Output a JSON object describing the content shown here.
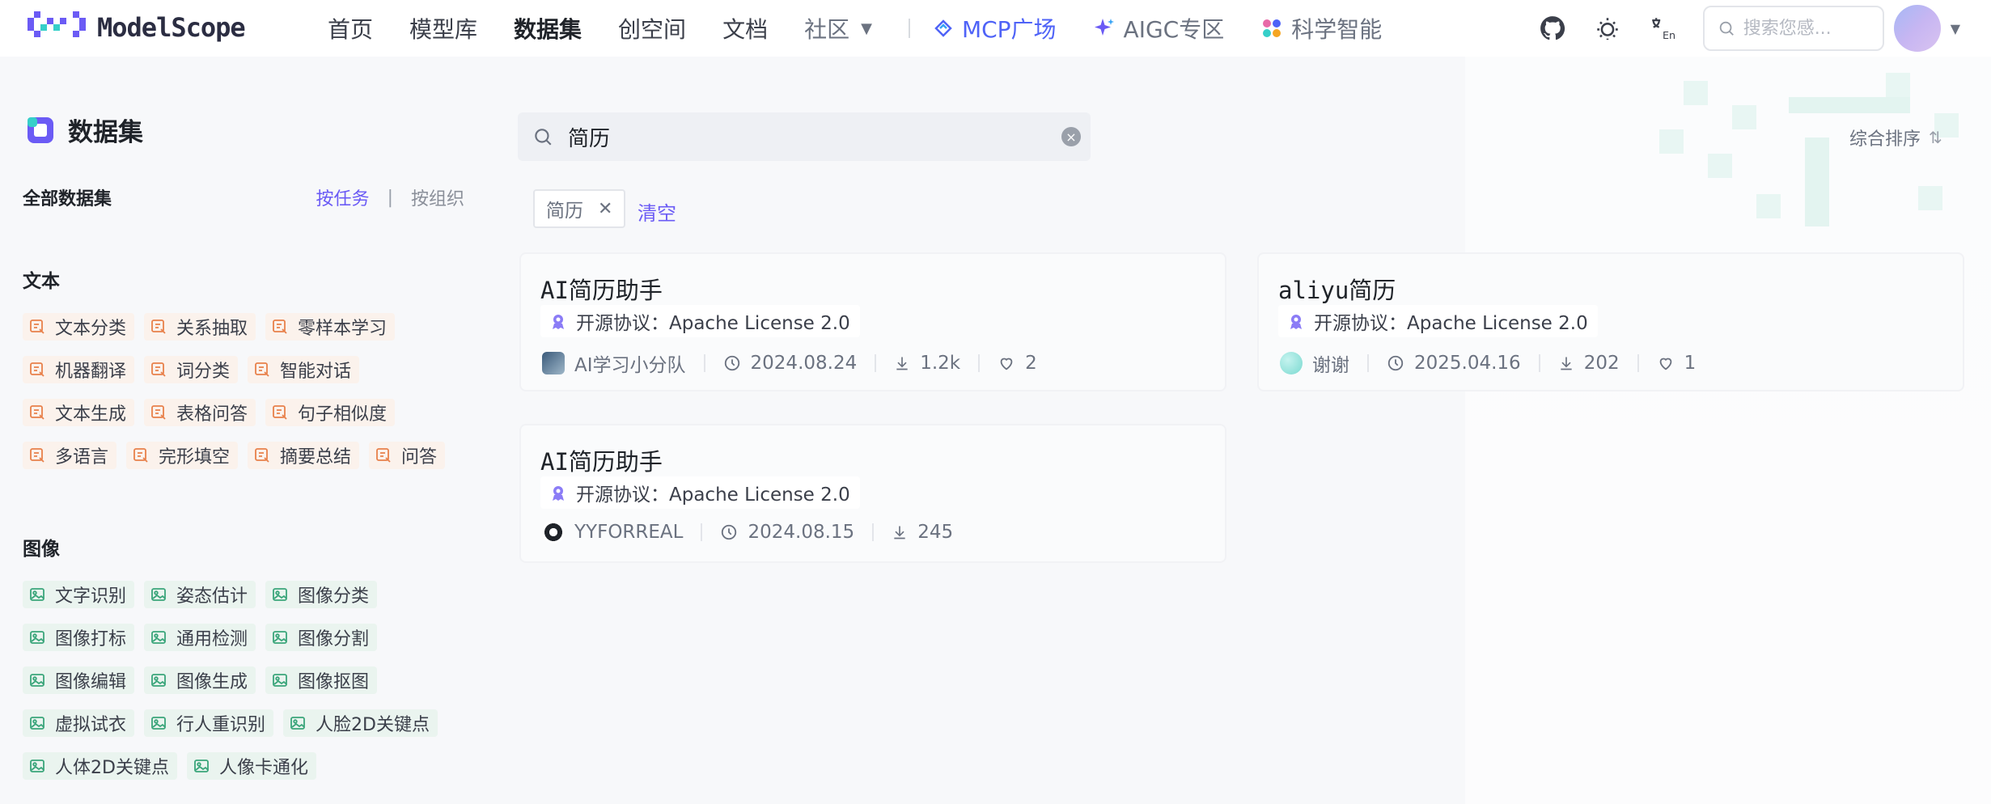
{
  "header": {
    "logo_text": "ModelScope",
    "nav": [
      {
        "label": "首页"
      },
      {
        "label": "模型库"
      },
      {
        "label": "数据集"
      },
      {
        "label": "创空间"
      },
      {
        "label": "文档"
      },
      {
        "label": "社区"
      }
    ],
    "special_nav": [
      {
        "label": "MCP广场",
        "icon": "mcp-icon",
        "color": "#4f63f7"
      },
      {
        "label": "AIGC专区",
        "icon": "sparkle-icon"
      },
      {
        "label": "科学智能",
        "icon": "science-icon"
      }
    ],
    "search_placeholder": "搜索您感..."
  },
  "sidebar": {
    "title": "数据集",
    "all_label": "全部数据集",
    "by_task": "按任务",
    "by_org": "按组织",
    "text_category": "文本",
    "text_tags": [
      [
        "文本分类",
        "关系抽取",
        "零样本学习"
      ],
      [
        "机器翻译",
        "词分类",
        "智能对话"
      ],
      [
        "文本生成",
        "表格问答",
        "句子相似度"
      ],
      [
        "多语言",
        "完形填空",
        "摘要总结",
        "问答"
      ]
    ],
    "image_category": "图像",
    "image_tags": [
      [
        "文字识别",
        "姿态估计",
        "图像分类"
      ],
      [
        "图像打标",
        "通用检测",
        "图像分割"
      ],
      [
        "图像编辑",
        "图像生成",
        "图像抠图"
      ],
      [
        "虚拟试衣",
        "行人重识别",
        "人脸2D关键点"
      ],
      [
        "人体2D关键点",
        "人像卡通化"
      ]
    ],
    "colors": {
      "text_tag_bg": "#fbf2ec",
      "text_tag_icon": "#e8804a",
      "image_tag_bg": "#eaf4ef",
      "image_tag_icon": "#3aa57a"
    }
  },
  "main": {
    "search_value": "简历",
    "filter_chip": "简历",
    "clear_label": "清空",
    "sort_label": "综合排序",
    "cards": [
      {
        "title": "AI简历助手",
        "license": "开源协议：Apache License 2.0",
        "owner": "AI学习小分队",
        "date": "2024.08.24",
        "downloads": "1.2k",
        "likes": "2"
      },
      {
        "title": "aliyu简历",
        "license": "开源协议：Apache License 2.0",
        "owner": "谢谢",
        "date": "2025.04.16",
        "downloads": "202",
        "likes": "1"
      },
      {
        "title": "AI简历助手",
        "license": "开源协议：Apache License 2.0",
        "owner": "YYFORREAL",
        "date": "2024.08.15",
        "downloads": "245"
      }
    ],
    "accent": "#6b5bf5"
  }
}
